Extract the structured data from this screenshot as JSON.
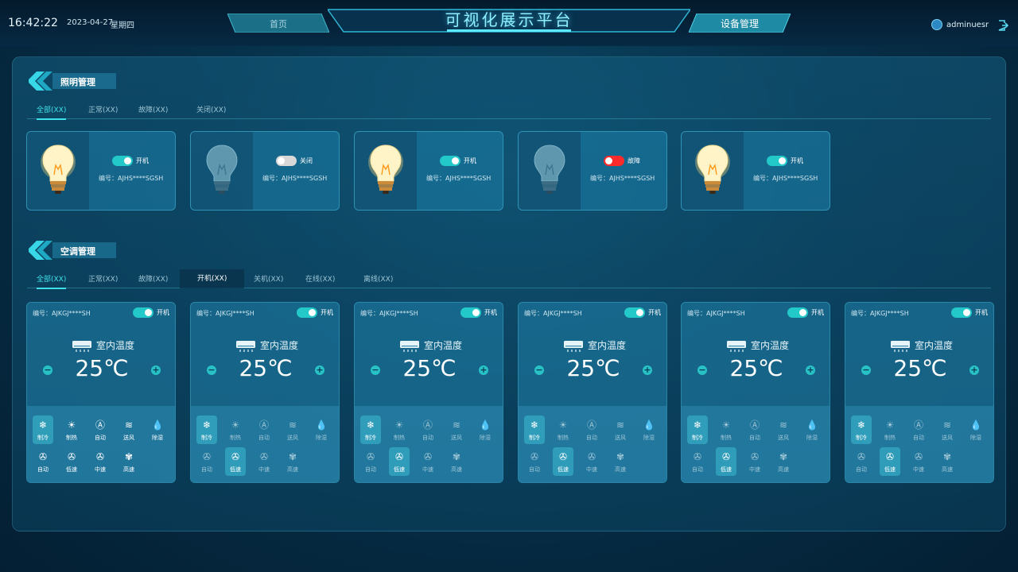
{
  "header": {
    "time": "16:42:22",
    "date": "2023-04-27",
    "weekday": "星期四",
    "title": "可视化展示平台",
    "nav_left": "首页",
    "nav_right": "设备管理",
    "username": "adminuesr"
  },
  "lighting": {
    "title": "照明管理",
    "tabs": [
      "全部(XX)",
      "正常(XX)",
      "故障(XX)",
      "关闭(XX)"
    ],
    "cards": [
      {
        "state": "开机",
        "serial": "编号：AJHS****SGSH",
        "switch": "on",
        "lit": true
      },
      {
        "state": "关闭",
        "serial": "编号：AJHS****SGSH",
        "switch": "off",
        "lit": false
      },
      {
        "state": "开机",
        "serial": "编号：AJHS****SGSH",
        "switch": "on",
        "lit": true
      },
      {
        "state": "故障",
        "serial": "编号：AJHS****SGSH",
        "switch": "fault",
        "lit": false
      },
      {
        "state": "开机",
        "serial": "编号：AJHS****SGSH",
        "switch": "on",
        "lit": true
      }
    ]
  },
  "ac": {
    "title": "空调管理",
    "tabs": [
      "全部(XX)",
      "正常(XX)",
      "故障(XX)",
      "开机(XX)",
      "关机(XX)",
      "在线(XX)",
      "离线(XX)"
    ],
    "temp_label": "室内温度",
    "modes": [
      "制冷",
      "制热",
      "自动",
      "送风",
      "除湿"
    ],
    "speeds": [
      "自动",
      "低速",
      "中速",
      "高速"
    ],
    "cards": [
      {
        "serial": "编号：AJKGJ****SH",
        "state": "开机",
        "temp": "25℃"
      },
      {
        "serial": "编号：AJKGJ****SH",
        "state": "开机",
        "temp": "25℃"
      },
      {
        "serial": "编号：AJKGJ****SH",
        "state": "开机",
        "temp": "25℃"
      },
      {
        "serial": "编号：AJKGJ****SH",
        "state": "开机",
        "temp": "25℃"
      },
      {
        "serial": "编号：AJKGJ****SH",
        "state": "开机",
        "temp": "25℃"
      },
      {
        "serial": "编号：AJKGJ****SH",
        "state": "开机",
        "temp": "25℃"
      }
    ]
  },
  "colors": {
    "accent": "#3fe0e8",
    "switch_on": "#23c8c8",
    "switch_fault": "#ff2a2a",
    "title_glow": "#8ef0ff"
  }
}
